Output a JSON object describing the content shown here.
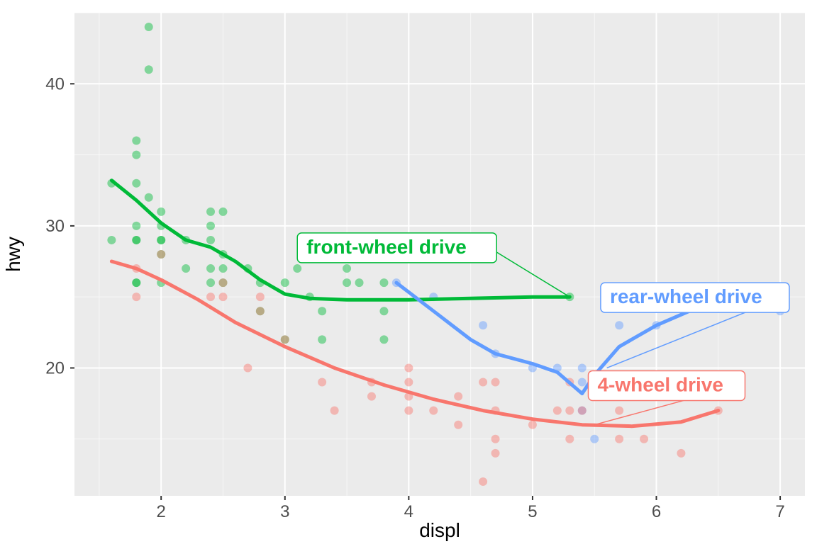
{
  "chart_data": {
    "type": "scatter",
    "xlabel": "displ",
    "ylabel": "hwy",
    "xlim": [
      1.3,
      7.2
    ],
    "ylim": [
      11,
      45
    ],
    "x_ticks": [
      2,
      3,
      4,
      5,
      6,
      7
    ],
    "y_ticks": [
      20,
      30,
      40
    ],
    "grid": true,
    "colors": {
      "4-wheel drive": "#F8766D",
      "front-wheel drive": "#00BA38",
      "rear-wheel drive": "#619CFF"
    },
    "annotations": [
      {
        "text": "front-wheel drive",
        "color": "#00BA38",
        "box_x": 3.1,
        "box_y": 29.5,
        "target_x": 5.3,
        "target_y": 25
      },
      {
        "text": "rear-wheel drive",
        "color": "#619CFF",
        "box_x": 5.55,
        "box_y": 26.0,
        "target_x": 5.6,
        "target_y": 20
      },
      {
        "text": "4-wheel drive",
        "color": "#F8766D",
        "box_x": 5.45,
        "box_y": 19.8,
        "target_x": 5.5,
        "target_y": 16
      }
    ],
    "series": [
      {
        "name": "front-wheel drive",
        "color": "#00BA38",
        "smooth": [
          {
            "x": 1.6,
            "y": 33.2
          },
          {
            "x": 1.8,
            "y": 31.8
          },
          {
            "x": 2.0,
            "y": 30.2
          },
          {
            "x": 2.2,
            "y": 29.0
          },
          {
            "x": 2.4,
            "y": 28.5
          },
          {
            "x": 2.6,
            "y": 27.5
          },
          {
            "x": 2.8,
            "y": 26.2
          },
          {
            "x": 3.0,
            "y": 25.2
          },
          {
            "x": 3.2,
            "y": 24.9
          },
          {
            "x": 3.5,
            "y": 24.8
          },
          {
            "x": 4.0,
            "y": 24.8
          },
          {
            "x": 4.5,
            "y": 24.9
          },
          {
            "x": 5.0,
            "y": 25.0
          },
          {
            "x": 5.3,
            "y": 25.0
          }
        ],
        "points": [
          {
            "x": 1.6,
            "y": 29
          },
          {
            "x": 1.6,
            "y": 33
          },
          {
            "x": 1.8,
            "y": 29
          },
          {
            "x": 1.8,
            "y": 29
          },
          {
            "x": 1.8,
            "y": 30
          },
          {
            "x": 1.8,
            "y": 35
          },
          {
            "x": 1.8,
            "y": 36
          },
          {
            "x": 1.8,
            "y": 26
          },
          {
            "x": 1.8,
            "y": 26
          },
          {
            "x": 1.8,
            "y": 33
          },
          {
            "x": 1.9,
            "y": 44
          },
          {
            "x": 1.9,
            "y": 41
          },
          {
            "x": 1.9,
            "y": 32
          },
          {
            "x": 2.0,
            "y": 26
          },
          {
            "x": 2.0,
            "y": 29
          },
          {
            "x": 2.0,
            "y": 28
          },
          {
            "x": 2.0,
            "y": 30
          },
          {
            "x": 2.0,
            "y": 31
          },
          {
            "x": 2.0,
            "y": 29
          },
          {
            "x": 2.2,
            "y": 27
          },
          {
            "x": 2.2,
            "y": 29
          },
          {
            "x": 2.4,
            "y": 27
          },
          {
            "x": 2.4,
            "y": 30
          },
          {
            "x": 2.4,
            "y": 31
          },
          {
            "x": 2.4,
            "y": 26
          },
          {
            "x": 2.4,
            "y": 29
          },
          {
            "x": 2.5,
            "y": 26
          },
          {
            "x": 2.5,
            "y": 31
          },
          {
            "x": 2.5,
            "y": 28
          },
          {
            "x": 2.5,
            "y": 27
          },
          {
            "x": 2.7,
            "y": 27
          },
          {
            "x": 2.8,
            "y": 26
          },
          {
            "x": 2.8,
            "y": 24
          },
          {
            "x": 3.0,
            "y": 26
          },
          {
            "x": 3.0,
            "y": 22
          },
          {
            "x": 3.1,
            "y": 27
          },
          {
            "x": 3.3,
            "y": 28
          },
          {
            "x": 3.3,
            "y": 24
          },
          {
            "x": 3.5,
            "y": 29
          },
          {
            "x": 3.5,
            "y": 26
          },
          {
            "x": 3.5,
            "y": 27
          },
          {
            "x": 3.6,
            "y": 26
          },
          {
            "x": 3.8,
            "y": 26
          },
          {
            "x": 3.8,
            "y": 28
          },
          {
            "x": 3.8,
            "y": 24
          },
          {
            "x": 3.8,
            "y": 22
          },
          {
            "x": 5.3,
            "y": 25
          },
          {
            "x": 3.3,
            "y": 22
          },
          {
            "x": 3.2,
            "y": 25
          }
        ]
      },
      {
        "name": "rear-wheel drive",
        "color": "#619CFF",
        "smooth": [
          {
            "x": 3.9,
            "y": 26.0
          },
          {
            "x": 4.2,
            "y": 24.0
          },
          {
            "x": 4.5,
            "y": 22.0
          },
          {
            "x": 4.7,
            "y": 21.0
          },
          {
            "x": 5.0,
            "y": 20.3
          },
          {
            "x": 5.2,
            "y": 19.7
          },
          {
            "x": 5.4,
            "y": 18.2
          },
          {
            "x": 5.5,
            "y": 19.5
          },
          {
            "x": 5.7,
            "y": 21.5
          },
          {
            "x": 6.0,
            "y": 23.0
          },
          {
            "x": 6.4,
            "y": 24.5
          },
          {
            "x": 6.8,
            "y": 24.6
          },
          {
            "x": 7.0,
            "y": 24.2
          }
        ],
        "points": [
          {
            "x": 3.9,
            "y": 26
          },
          {
            "x": 4.2,
            "y": 25
          },
          {
            "x": 4.6,
            "y": 23
          },
          {
            "x": 4.7,
            "y": 21
          },
          {
            "x": 5.0,
            "y": 20
          },
          {
            "x": 5.2,
            "y": 20
          },
          {
            "x": 5.4,
            "y": 17
          },
          {
            "x": 5.4,
            "y": 20
          },
          {
            "x": 5.4,
            "y": 19
          },
          {
            "x": 5.7,
            "y": 23
          },
          {
            "x": 5.7,
            "y": 18
          },
          {
            "x": 6.0,
            "y": 23
          },
          {
            "x": 6.2,
            "y": 25
          },
          {
            "x": 7.0,
            "y": 24
          },
          {
            "x": 5.5,
            "y": 15
          }
        ]
      },
      {
        "name": "4-wheel drive",
        "color": "#F8766D",
        "smooth": [
          {
            "x": 1.6,
            "y": 27.5
          },
          {
            "x": 1.8,
            "y": 27.0
          },
          {
            "x": 2.0,
            "y": 26.2
          },
          {
            "x": 2.3,
            "y": 24.8
          },
          {
            "x": 2.6,
            "y": 23.2
          },
          {
            "x": 3.0,
            "y": 21.5
          },
          {
            "x": 3.4,
            "y": 20.0
          },
          {
            "x": 3.8,
            "y": 18.8
          },
          {
            "x": 4.2,
            "y": 17.8
          },
          {
            "x": 4.6,
            "y": 17.0
          },
          {
            "x": 5.0,
            "y": 16.4
          },
          {
            "x": 5.4,
            "y": 16.0
          },
          {
            "x": 5.8,
            "y": 15.9
          },
          {
            "x": 6.2,
            "y": 16.2
          },
          {
            "x": 6.5,
            "y": 17.0
          }
        ],
        "points": [
          {
            "x": 1.8,
            "y": 25
          },
          {
            "x": 1.8,
            "y": 27
          },
          {
            "x": 2.0,
            "y": 28
          },
          {
            "x": 2.4,
            "y": 25
          },
          {
            "x": 2.5,
            "y": 25
          },
          {
            "x": 2.5,
            "y": 26
          },
          {
            "x": 2.8,
            "y": 24
          },
          {
            "x": 2.8,
            "y": 25
          },
          {
            "x": 2.7,
            "y": 20
          },
          {
            "x": 3.0,
            "y": 22
          },
          {
            "x": 3.3,
            "y": 19
          },
          {
            "x": 3.4,
            "y": 17
          },
          {
            "x": 3.7,
            "y": 19
          },
          {
            "x": 3.7,
            "y": 18
          },
          {
            "x": 4.0,
            "y": 20
          },
          {
            "x": 4.0,
            "y": 18
          },
          {
            "x": 4.0,
            "y": 17
          },
          {
            "x": 4.0,
            "y": 19
          },
          {
            "x": 4.2,
            "y": 17
          },
          {
            "x": 4.4,
            "y": 18
          },
          {
            "x": 4.6,
            "y": 19
          },
          {
            "x": 4.6,
            "y": 12
          },
          {
            "x": 4.7,
            "y": 17
          },
          {
            "x": 4.7,
            "y": 15
          },
          {
            "x": 4.7,
            "y": 19
          },
          {
            "x": 4.7,
            "y": 14
          },
          {
            "x": 5.2,
            "y": 17
          },
          {
            "x": 5.3,
            "y": 19
          },
          {
            "x": 5.3,
            "y": 15
          },
          {
            "x": 5.3,
            "y": 17
          },
          {
            "x": 5.4,
            "y": 17
          },
          {
            "x": 5.6,
            "y": 18
          },
          {
            "x": 5.7,
            "y": 17
          },
          {
            "x": 5.7,
            "y": 15
          },
          {
            "x": 5.9,
            "y": 18
          },
          {
            "x": 5.9,
            "y": 15
          },
          {
            "x": 6.5,
            "y": 17
          },
          {
            "x": 6.2,
            "y": 14
          },
          {
            "x": 5.0,
            "y": 16
          },
          {
            "x": 4.4,
            "y": 16
          }
        ]
      }
    ]
  }
}
